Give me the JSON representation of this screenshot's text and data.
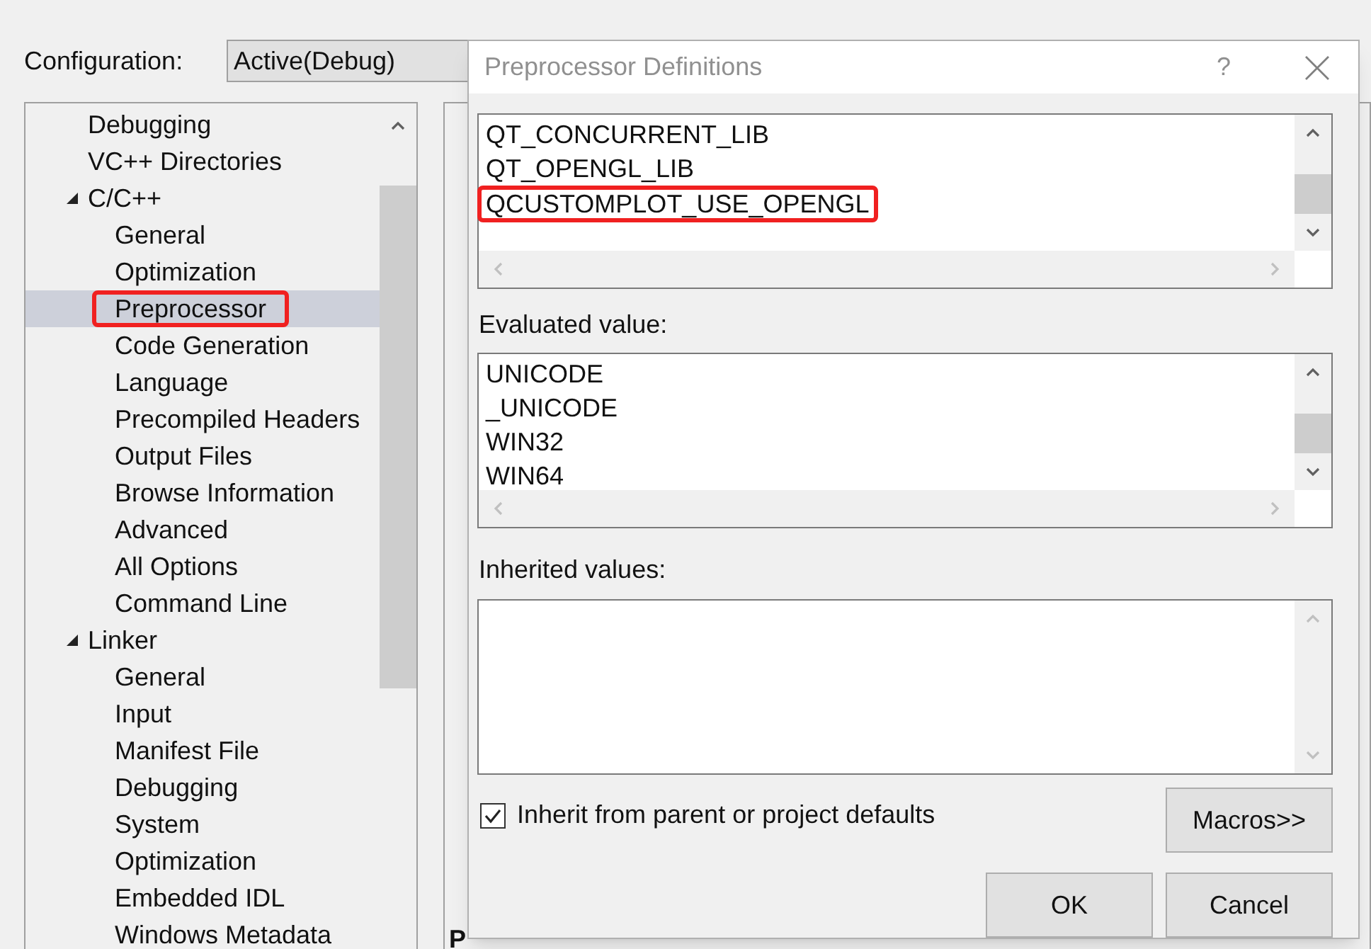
{
  "configuration": {
    "label": "Configuration:",
    "value": "Active(Debug)"
  },
  "tree": [
    {
      "label": "Debugging",
      "selected": false,
      "highlighted": false
    },
    {
      "label": "VC++ Directories",
      "selected": false,
      "highlighted": false
    },
    {
      "label": "C/C++",
      "selected": false,
      "highlighted": false,
      "expanded": true,
      "children": [
        {
          "label": "General",
          "selected": false,
          "highlighted": false
        },
        {
          "label": "Optimization",
          "selected": false,
          "highlighted": false
        },
        {
          "label": "Preprocessor",
          "selected": true,
          "highlighted": true
        },
        {
          "label": "Code Generation",
          "selected": false,
          "highlighted": false
        },
        {
          "label": "Language",
          "selected": false,
          "highlighted": false
        },
        {
          "label": "Precompiled Headers",
          "selected": false,
          "highlighted": false
        },
        {
          "label": "Output Files",
          "selected": false,
          "highlighted": false
        },
        {
          "label": "Browse Information",
          "selected": false,
          "highlighted": false
        },
        {
          "label": "Advanced",
          "selected": false,
          "highlighted": false
        },
        {
          "label": "All Options",
          "selected": false,
          "highlighted": false
        },
        {
          "label": "Command Line",
          "selected": false,
          "highlighted": false
        }
      ]
    },
    {
      "label": "Linker",
      "selected": false,
      "highlighted": false,
      "expanded": true,
      "children": [
        {
          "label": "General",
          "selected": false,
          "highlighted": false
        },
        {
          "label": "Input",
          "selected": false,
          "highlighted": false
        },
        {
          "label": "Manifest File",
          "selected": false,
          "highlighted": false
        },
        {
          "label": "Debugging",
          "selected": false,
          "highlighted": false
        },
        {
          "label": "System",
          "selected": false,
          "highlighted": false
        },
        {
          "label": "Optimization",
          "selected": false,
          "highlighted": false
        },
        {
          "label": "Embedded IDL",
          "selected": false,
          "highlighted": false
        },
        {
          "label": "Windows Metadata",
          "selected": false,
          "highlighted": false
        }
      ]
    }
  ],
  "background_panel": {
    "heading": "P"
  },
  "dialog": {
    "title": "Preprocessor Definitions",
    "help": "?",
    "definitions": [
      {
        "text": "QT_CONCURRENT_LIB",
        "highlighted": false
      },
      {
        "text": "QT_OPENGL_LIB",
        "highlighted": false
      },
      {
        "text": "QCUSTOMPLOT_USE_OPENGL",
        "highlighted": true
      }
    ],
    "evaluated_label": "Evaluated value:",
    "evaluated": [
      "UNICODE",
      "_UNICODE",
      "WIN32",
      "WIN64"
    ],
    "inherited_label": "Inherited values:",
    "inherit_checkbox": {
      "label": "Inherit from parent or project defaults",
      "checked": true
    },
    "buttons": {
      "macros": "Macros>>",
      "ok": "OK",
      "cancel": "Cancel"
    }
  }
}
